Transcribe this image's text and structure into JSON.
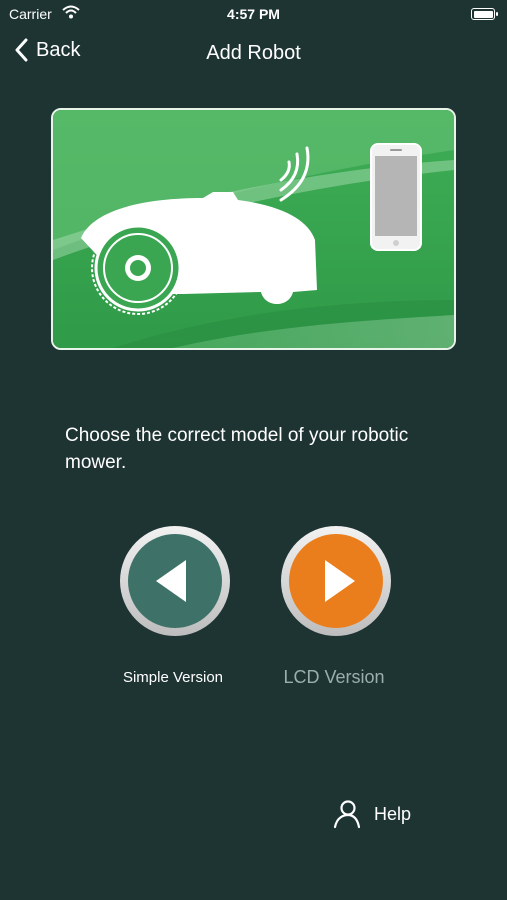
{
  "status_bar": {
    "carrier": "Carrier",
    "time": "4:57 PM"
  },
  "nav": {
    "back_label": "Back",
    "title": "Add Robot"
  },
  "instruction": "Choose the correct model of your robotic mower.",
  "choices": [
    {
      "label": "Simple Version",
      "color": "#3e7168"
    },
    {
      "label": "LCD Version",
      "color": "#ea7d1c"
    }
  ],
  "help_label": "Help",
  "colors": {
    "background": "#1e3433",
    "hero_green": "#3cab56",
    "accent_orange": "#ea7d1c",
    "teal": "#3e7168"
  }
}
